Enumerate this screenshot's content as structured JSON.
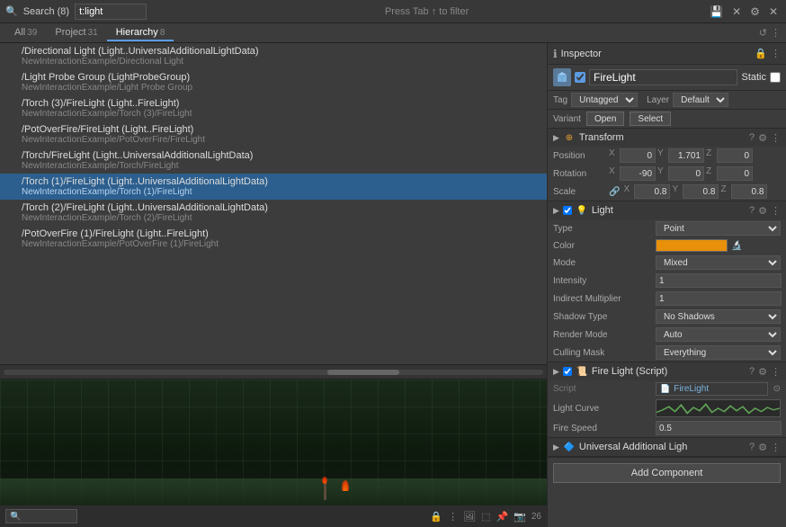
{
  "topbar": {
    "title": "Search (8)",
    "search_value": "t:light",
    "press_tab_hint": "Press Tab ↑ to filter",
    "filter_placeholder": "t:light"
  },
  "tabs": {
    "all": {
      "label": "All",
      "count": "39"
    },
    "project": {
      "label": "Project",
      "count": "31"
    },
    "hierarchy": {
      "label": "Hierarchy",
      "count": "8"
    }
  },
  "hierarchy_items": [
    {
      "main": "/Directional Light (Light..UniversalAdditionalLightData)",
      "sub": "NewInteractionExample/Directional Light"
    },
    {
      "main": "/Light Probe Group (LightProbeGroup)",
      "sub": "NewInteractionExample/Light Probe Group"
    },
    {
      "main": "/Torch (3)/FireLight (Light..FireLight)",
      "sub": "NewInteractionExample/Torch (3)/FireLight"
    },
    {
      "main": "/PotOverFire/FireLight (Light..FireLight)",
      "sub": "NewInteractionExample/PotOverFire/FireLight"
    },
    {
      "main": "/Torch/FireLight (Light..UniversalAdditionalLightData)",
      "sub": "NewInteractionExample/Torch/FireLight"
    },
    {
      "main": "/Torch (1)/FireLight (Light..UniversalAdditionalLightData)",
      "sub": "NewInteractionExample/Torch (1)/FireLight",
      "selected": true
    },
    {
      "main": "/Torch (2)/FireLight (Light..UniversalAdditionalLightData)",
      "sub": "NewInteractionExample/Torch (2)/FireLight"
    },
    {
      "main": "/PotOverFire (1)/FireLight (Light..FireLight)",
      "sub": "NewInteractionExample/PotOverFire (1)/FireLight"
    }
  ],
  "scene_bottom": {
    "search_placeholder": "🔍",
    "object_count": "26"
  },
  "inspector": {
    "title": "Inspector",
    "gameobject_name": "FireLight",
    "static_label": "Static",
    "tag_label": "Tag",
    "tag_value": "Untagged",
    "layer_label": "Layer",
    "layer_value": "Default",
    "variant_label": "Variant",
    "open_btn": "Open",
    "select_btn": "Select"
  },
  "transform": {
    "title": "Transform",
    "position_label": "Position",
    "pos_x": "0",
    "pos_y": "1.701",
    "pos_z": "0",
    "rotation_label": "Rotation",
    "rot_x": "-90",
    "rot_y": "0",
    "rot_z": "0",
    "scale_label": "Scale",
    "scale_x": "0.8",
    "scale_y": "0.8",
    "scale_z": "0.8"
  },
  "light": {
    "title": "Light",
    "type_label": "Type",
    "type_value": "Point",
    "color_label": "Color",
    "mode_label": "Mode",
    "mode_value": "Mixed",
    "intensity_label": "Intensity",
    "intensity_value": "1",
    "indirect_label": "Indirect Multiplier",
    "indirect_value": "1",
    "shadow_label": "Shadow Type",
    "shadow_value": "No Shadows",
    "render_label": "Render Mode",
    "render_value": "Auto",
    "culling_label": "Culling Mask",
    "culling_value": "Everything"
  },
  "fire_light_script": {
    "title": "Fire Light (Script)",
    "script_label": "Script",
    "script_value": "FireLight",
    "light_curve_label": "Light Curve",
    "fire_speed_label": "Fire Speed",
    "fire_speed_value": "0.5"
  },
  "ual": {
    "title": "Universal Additional Ligh"
  },
  "add_component": {
    "label": "Add Component"
  }
}
